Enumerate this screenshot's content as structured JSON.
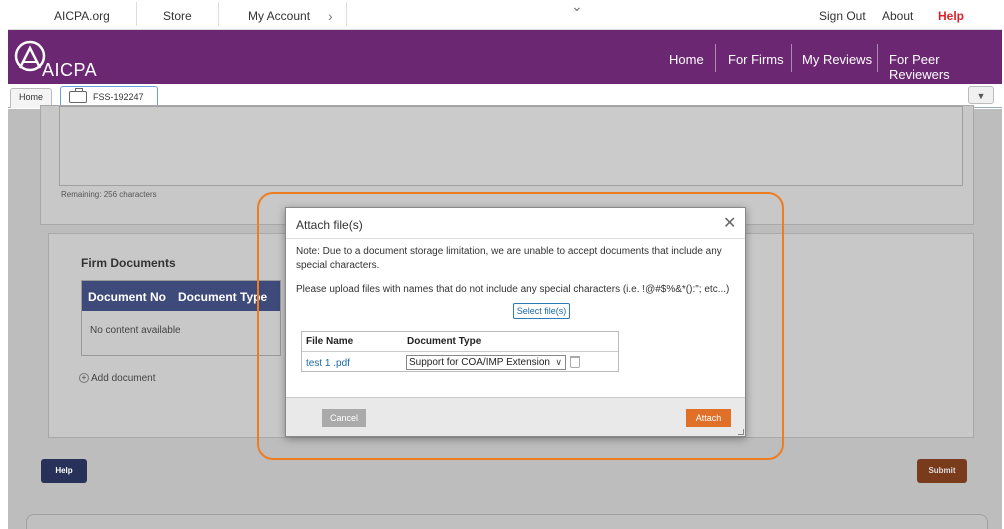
{
  "util_bar": {
    "aicpa_org": "AICPA.org",
    "store": "Store",
    "my_account": "My Account",
    "chevron": "›",
    "center_chevron": "⌄",
    "sign_out": "Sign Out",
    "about": "About",
    "help": "Help"
  },
  "header": {
    "logo_text": "AICPA",
    "nav": [
      "Home",
      "For Firms",
      "My Reviews",
      "For Peer Reviewers"
    ]
  },
  "tabs": {
    "home": "Home",
    "current": "FSS-192247",
    "dropdown": "▼"
  },
  "page": {
    "remaining": "Remaining: 256 characters",
    "firm_documents": {
      "title": "Firm Documents",
      "columns": [
        "Document No",
        "Document Type"
      ],
      "empty": "No content available",
      "add_document": "Add document"
    },
    "help_button": "Help",
    "submit_button": "Submit"
  },
  "modal": {
    "title": "Attach file(s)",
    "close": "✕",
    "note": "Note: Due to a document storage limitation, we are unable to accept documents that include any special characters.",
    "instruction": "Please upload files with names that do not include any special characters (i.e. !@#$%&*():\"; etc...)",
    "select_files": "Select file(s)",
    "table": {
      "headers": [
        "File Name",
        "Document Type"
      ],
      "rows": [
        {
          "file_name": "test 1 .pdf",
          "document_type": "Support for COA/IMP Extension"
        }
      ]
    },
    "cancel": "Cancel",
    "attach": "Attach"
  },
  "colors": {
    "brand_purple": "#6b2772",
    "table_header": "#3e4b7a",
    "attach_orange": "#e07028",
    "annotation_orange": "#ee7d22",
    "help_red": "#e0202a"
  }
}
